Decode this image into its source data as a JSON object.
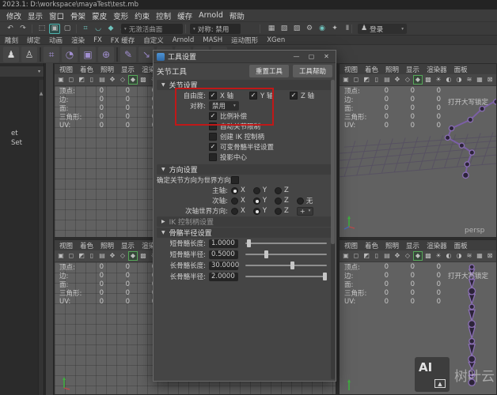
{
  "window": {
    "title": "2023.1: D:\\workspace\\mayaTest\\test.mb"
  },
  "menu_bar": {
    "items": [
      "修改",
      "显示",
      "窗口",
      "骨架",
      "蒙皮",
      "变形",
      "约束",
      "控制",
      "缓存",
      "Arnold",
      "帮助"
    ]
  },
  "status_bar": {
    "history_icons": [
      {
        "name": "undo-icon",
        "glyph": "↶"
      },
      {
        "name": "redo-icon",
        "glyph": "↷"
      }
    ],
    "mode_icons": [
      {
        "name": "hierarchy-mode-icon",
        "glyph": "⬚"
      },
      {
        "name": "object-mode-icon",
        "glyph": "▣",
        "on": true
      },
      {
        "name": "component-mode-icon",
        "glyph": "▢"
      }
    ],
    "snap_icons": [
      {
        "name": "snap-grid-icon",
        "glyph": "⌗",
        "teal": true
      },
      {
        "name": "snap-curve-icon",
        "glyph": "◡",
        "teal": true
      },
      {
        "name": "snap-point-icon",
        "glyph": "◆",
        "teal": true
      },
      {
        "name": "snap-plane-icon",
        "glyph": "▱",
        "teal": true
      },
      {
        "name": "snap-center-icon",
        "glyph": "⊙",
        "teal": true
      },
      {
        "name": "make-live-icon",
        "glyph": "◈",
        "teal": true
      }
    ],
    "surface_field": "无激活曲面",
    "symmetry_field": "对称: 禁用",
    "render_icons": [
      {
        "name": "render-icon",
        "glyph": "▦"
      },
      {
        "name": "ipr-render-icon",
        "glyph": "▧"
      },
      {
        "name": "render-region-icon",
        "glyph": "▨"
      },
      {
        "name": "render-settings-icon",
        "glyph": "⚙"
      },
      {
        "name": "hypershade-icon",
        "glyph": "◉",
        "teal": true
      },
      {
        "name": "light-editor-icon",
        "glyph": "✦"
      },
      {
        "name": "pause-icon",
        "glyph": "Ⅱ"
      }
    ],
    "sign_in_label": "登录"
  },
  "shelf": {
    "tabs": [
      "雕刻",
      "绑定",
      "动画",
      "渲染",
      "FX",
      "FX 缓存",
      "自定义",
      "Arnold",
      "MASH",
      "运动图形",
      "XGen"
    ],
    "icons": [
      {
        "name": "humanik-character-icon",
        "glyph": "♟",
        "color": "#d8d8d8"
      },
      {
        "name": "humanik-skeleton-icon",
        "glyph": "♙",
        "color": "#d8d8d8"
      },
      {
        "name": "shelf-divider-icon",
        "divider": true
      },
      {
        "name": "tension-deformer-icon",
        "glyph": "⌗",
        "color": "#a18fd0"
      },
      {
        "name": "solidify-deformer-icon",
        "glyph": "◔",
        "color": "#a18fd0"
      },
      {
        "name": "lattice-deformer-icon",
        "glyph": "▣",
        "color": "#a18fd0"
      },
      {
        "name": "cluster-deformer-icon",
        "glyph": "⊕",
        "color": "#a18fd0"
      },
      {
        "name": "shelf-divider-icon",
        "divider": true
      },
      {
        "name": "create-joints-icon",
        "glyph": "✎",
        "color": "#a18fd0"
      },
      {
        "name": "ik-handle-icon",
        "glyph": "↘",
        "color": "#a18fd0"
      },
      {
        "name": "ik-spline-handle-icon",
        "glyph": "∿",
        "color": "#a18fd0"
      },
      {
        "name": "insert-joints-icon",
        "glyph": "⌁",
        "color": "#a18fd0"
      },
      {
        "name": "mirror-joints-icon",
        "glyph": "✚",
        "color": "#d4884a"
      },
      {
        "name": "orient-joint-icon",
        "glyph": "✦",
        "color": "#d4884a"
      }
    ]
  },
  "outliner": {
    "items": [
      "et",
      "Set"
    ]
  },
  "viewport": {
    "menu_items": [
      "视图",
      "着色",
      "照明",
      "显示",
      "渲染器",
      "面板"
    ],
    "toolbar_icons": [
      {
        "name": "camera-select-icon",
        "glyph": "▣"
      },
      {
        "name": "lock-camera-icon",
        "glyph": "◻"
      },
      {
        "name": "camera-attributes-icon",
        "glyph": "◩"
      },
      {
        "name": "bookmark-icon",
        "glyph": "▯"
      },
      {
        "name": "image-plane-icon",
        "glyph": "▤"
      },
      {
        "name": "two-d-pan-zoom-icon",
        "glyph": "✥"
      },
      {
        "name": "wireframe-icon",
        "glyph": "◇"
      },
      {
        "name": "shaded-mode-icon",
        "glyph": "◆",
        "on": true
      },
      {
        "name": "textured-mode-icon",
        "glyph": "▩"
      },
      {
        "name": "lighting-icon",
        "glyph": "☀"
      },
      {
        "name": "shadows-icon",
        "glyph": "◐"
      },
      {
        "name": "screen-ao-icon",
        "glyph": "◑"
      },
      {
        "name": "motion-blur-icon",
        "glyph": "≋"
      },
      {
        "name": "multisample-icon",
        "glyph": "▦",
        "teal": true
      },
      {
        "name": "xray-icon",
        "glyph": "⊠"
      }
    ],
    "hud_rows": [
      {
        "label": "顶点:",
        "v1": "0",
        "v2": "0",
        "v3": "0"
      },
      {
        "label": "边:",
        "v1": "0",
        "v2": "0",
        "v3": "0"
      },
      {
        "label": "面:",
        "v1": "0",
        "v2": "0",
        "v3": "0"
      },
      {
        "label": "三角形:",
        "v1": "0",
        "v2": "0",
        "v3": "0"
      },
      {
        "label": "UV:",
        "v1": "0",
        "v2": "0",
        "v3": "0"
      }
    ],
    "caps_lock_warning": "打开大写锁定",
    "persp_label": "persp"
  },
  "dialog": {
    "title": "工具设置",
    "tool_name": "关节工具",
    "reset_button": "重置工具",
    "help_button": "工具帮助",
    "joint_settings": {
      "header": "关节设置",
      "dof_label": "自由度:",
      "axes": [
        {
          "label": "X 轴",
          "checked": true
        },
        {
          "label": "Y 轴",
          "checked": true
        },
        {
          "label": "Z 轴",
          "checked": true
        }
      ],
      "symmetry_label": "对称:",
      "symmetry_value": "禁用",
      "checkboxes": [
        {
          "label": "比例补偿",
          "checked": true
        },
        {
          "label": "自动关节限制",
          "checked": false
        },
        {
          "label": "创建 IK 控制柄",
          "checked": false
        },
        {
          "label": "可变骨骼半径设置",
          "checked": true
        },
        {
          "label": "投影中心",
          "checked": false
        }
      ]
    },
    "orientation_settings": {
      "header": "方向设置",
      "world_label": "确定关节方向为世界方向:",
      "world_checked": false,
      "primary_label": "主轴:",
      "primary_options": [
        {
          "label": "X",
          "on": true
        },
        {
          "label": "Y",
          "on": false
        },
        {
          "label": "Z",
          "on": false
        }
      ],
      "secondary_label": "次轴:",
      "secondary_options": [
        {
          "label": "X",
          "on": false
        },
        {
          "label": "Y",
          "on": true
        },
        {
          "label": "Z",
          "on": false
        },
        {
          "label": "无",
          "on": false
        }
      ],
      "secondary_world_label": "次轴世界方向:",
      "secondary_world_options": [
        {
          "label": "X",
          "on": false
        },
        {
          "label": "Y",
          "on": true
        },
        {
          "label": "Z",
          "on": false
        }
      ],
      "extra_dropdown_value": "+"
    },
    "ik_section": {
      "header": "IK 控制柄设置"
    },
    "bone_radius_settings": {
      "header": "骨骼半径设置",
      "rows": [
        {
          "label": "短骨骼长度:",
          "value": "1.0000",
          "pos": 2
        },
        {
          "label": "短骨骼半径:",
          "value": "0.5000",
          "pos": 23
        },
        {
          "label": "长骨骼长度:",
          "value": "30.0000",
          "pos": 55
        },
        {
          "label": "长骨骼半径:",
          "value": "2.0000",
          "pos": 95
        }
      ]
    }
  },
  "watermark": {
    "logo": "AI",
    "text": "树叶云"
  },
  "glyphs": {
    "chevron_down": "▾",
    "minimize": "—",
    "maximize": "▢",
    "close": "✕",
    "triangle_open": "▼",
    "triangle_closed": "▶",
    "check": "✓",
    "person": "♟",
    "scroll_up": "▲",
    "mountain": "▲"
  },
  "colors": {
    "annotation_red": "#c01818",
    "joint_purple": "#7b5fa6",
    "teal": "#52b5ae"
  }
}
